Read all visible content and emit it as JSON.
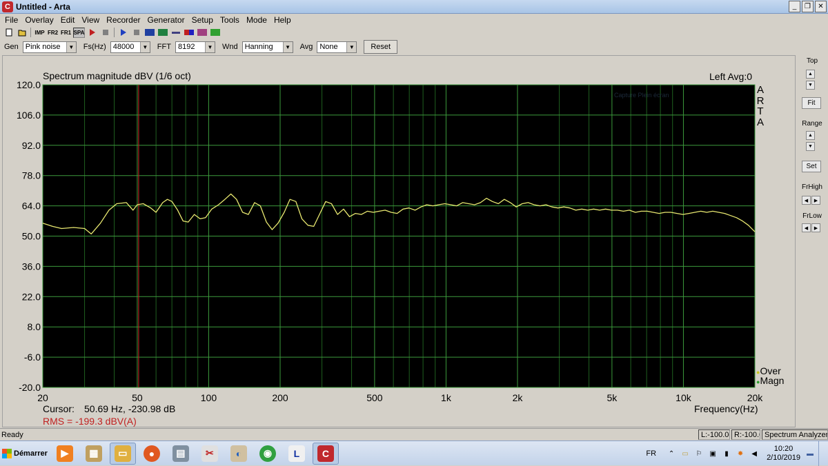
{
  "window": {
    "title": "Untitled - Arta",
    "icon_letter": "C",
    "minimize": "_",
    "restore": "❐",
    "close": "✕"
  },
  "menu": [
    "File",
    "Overlay",
    "Edit",
    "View",
    "Recorder",
    "Generator",
    "Setup",
    "Tools",
    "Mode",
    "Help"
  ],
  "toolbar": {
    "imp": "IMP",
    "fr2": "FR2",
    "fr1": "FR1",
    "spa": "SPA"
  },
  "controls": {
    "gen_label": "Gen",
    "gen_value": "Pink noise",
    "fs_label": "Fs(Hz)",
    "fs_value": "48000",
    "fft_label": "FFT",
    "fft_value": "8192",
    "wnd_label": "Wnd",
    "wnd_value": "Hanning",
    "avg_label": "Avg",
    "avg_value": "None",
    "reset_label": "Reset"
  },
  "plot": {
    "title": "Spectrum magnitude dBV (1/6 oct)",
    "channel_info": "Left  Avg:0",
    "arta_letters": [
      "A",
      "R",
      "T",
      "A"
    ],
    "watermark": "Capture Plein écran",
    "cursor_label": "Cursor:",
    "cursor_value": "50.69 Hz, -230.98 dB",
    "rms_text": "RMS = -199.3 dBV(A)",
    "xlabel": "Frequency(Hz)",
    "legend_over": "Over",
    "legend_magn": "Magn"
  },
  "chart_data": {
    "type": "line",
    "title": "Spectrum magnitude dBV (1/6 oct)",
    "xlabel": "Frequency(Hz)",
    "ylabel": "",
    "xscale": "log",
    "xlim": [
      20,
      20000
    ],
    "ylim": [
      -20,
      120
    ],
    "grid": true,
    "x_ticks": [
      "20",
      "50",
      "100",
      "200",
      "500",
      "1k",
      "2k",
      "5k",
      "10k",
      "20k"
    ],
    "y_ticks": [
      "120.0",
      "106.0",
      "92.0",
      "78.0",
      "64.0",
      "50.0",
      "36.0",
      "22.0",
      "8.0",
      "-6.0",
      "-20.0"
    ],
    "cursor_x": 50.69,
    "series": [
      {
        "name": "Magn",
        "color": "#e8e870",
        "x": [
          20,
          22,
          24,
          27,
          30,
          32,
          35,
          38,
          41,
          45,
          48,
          50,
          53,
          57,
          60,
          64,
          67,
          70,
          74,
          78,
          82,
          87,
          92,
          97,
          103,
          110,
          117,
          124,
          131,
          139,
          147,
          156,
          165,
          175,
          185,
          196,
          208,
          220,
          233,
          247,
          262,
          277,
          293,
          311,
          329,
          349,
          370,
          392,
          415,
          440,
          466,
          494,
          523,
          554,
          587,
          622,
          659,
          698,
          740,
          784,
          830,
          880,
          932,
          988,
          1047,
          1109,
          1175,
          1245,
          1319,
          1397,
          1480,
          1568,
          1661,
          1760,
          1865,
          1976,
          2093,
          2217,
          2349,
          2489,
          2637,
          2794,
          2960,
          3136,
          3322,
          3520,
          3729,
          3951,
          4186,
          4435,
          4699,
          4978,
          5274,
          5588,
          5920,
          6272,
          6645,
          7040,
          7459,
          7902,
          8372,
          8870,
          9397,
          9956,
          10548,
          11175,
          11840,
          12544,
          13290,
          14080,
          14917,
          15804,
          16744,
          17740,
          18795,
          20000
        ],
        "values": [
          56.0,
          54.5,
          53.5,
          54.0,
          53.5,
          51.0,
          56.0,
          62.0,
          65.0,
          65.5,
          62.0,
          64.5,
          65.0,
          63.0,
          61.0,
          65.5,
          67.0,
          66.0,
          62.0,
          57.0,
          56.5,
          60.0,
          58.0,
          58.5,
          62.5,
          64.5,
          67.0,
          69.5,
          67.0,
          61.0,
          60.0,
          65.5,
          64.0,
          56.5,
          53.0,
          56.0,
          61.0,
          67.0,
          66.0,
          58.0,
          55.0,
          54.5,
          60.0,
          66.0,
          65.0,
          60.0,
          62.5,
          59.0,
          60.5,
          60.0,
          61.5,
          61.0,
          61.5,
          62.0,
          61.0,
          60.5,
          62.5,
          63.0,
          62.0,
          63.5,
          64.5,
          64.0,
          64.5,
          65.0,
          64.5,
          64.0,
          65.5,
          65.0,
          64.5,
          65.5,
          67.5,
          66.0,
          65.0,
          67.0,
          65.5,
          63.5,
          65.0,
          65.5,
          64.5,
          64.0,
          64.5,
          63.5,
          63.0,
          63.5,
          63.0,
          62.0,
          62.5,
          62.0,
          62.5,
          62.0,
          62.5,
          62.0,
          62.0,
          61.5,
          62.0,
          61.0,
          61.5,
          61.5,
          61.0,
          60.5,
          61.0,
          61.0,
          60.5,
          60.0,
          60.5,
          61.0,
          61.5,
          61.0,
          61.5,
          61.0,
          60.5,
          59.5,
          58.5,
          57.0,
          55.0,
          52.0
        ]
      }
    ]
  },
  "side_panel": {
    "top_label": "Top",
    "fit_label": "Fit",
    "range_label": "Range",
    "set_label": "Set",
    "frhigh_label": "FrHigh",
    "frlow_label": "FrLow"
  },
  "status": {
    "ready": "Ready",
    "l_level": "L:-100.0d",
    "r_level": "R:-100.0",
    "mode": "Spectrum Analyzer"
  },
  "taskbar": {
    "start_label": "Démarrer",
    "language": "FR",
    "time": "10:20",
    "date": "2/10/2019"
  },
  "colors": {
    "plot_bg": "#000000",
    "grid_major": "#3c9a3c",
    "grid_minor": "#1f5f1f",
    "trace": "#e8e870",
    "cursor": "#b02020",
    "rms": "#c02020"
  }
}
